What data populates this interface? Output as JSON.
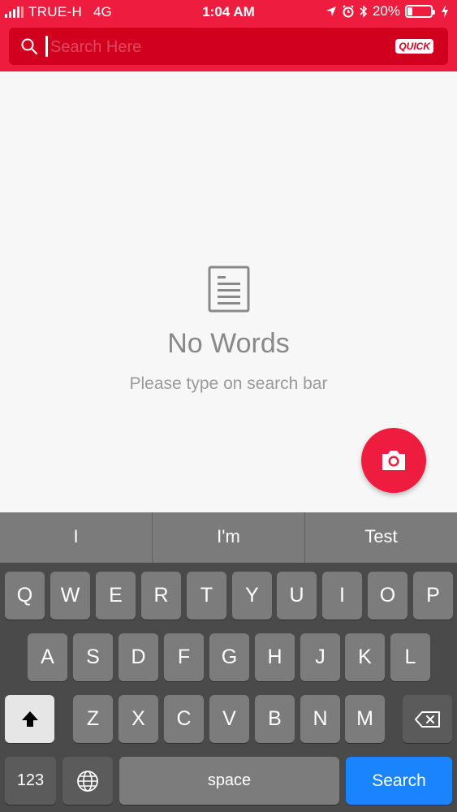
{
  "status_bar": {
    "carrier": "TRUE-H",
    "network": "4G",
    "time": "1:04 AM",
    "battery_percent": "20%",
    "battery_level": 0.2,
    "icons": [
      "location-arrow-icon",
      "alarm-icon",
      "bluetooth-icon",
      "battery-icon",
      "charging-icon"
    ]
  },
  "search": {
    "placeholder": "Search Here",
    "quick_label": "QUICK"
  },
  "empty_state": {
    "icon": "document-icon",
    "title": "No Words",
    "subtitle": "Please type on search bar"
  },
  "fab": {
    "icon": "camera-icon"
  },
  "keyboard": {
    "suggestions": [
      "I",
      "I'm",
      "Test"
    ],
    "row1": [
      "Q",
      "W",
      "E",
      "R",
      "T",
      "Y",
      "U",
      "I",
      "O",
      "P"
    ],
    "row2": [
      "A",
      "S",
      "D",
      "F",
      "G",
      "H",
      "J",
      "K",
      "L"
    ],
    "row3": [
      "Z",
      "X",
      "C",
      "V",
      "B",
      "N",
      "M"
    ],
    "numbers_label": "123",
    "space_label": "space",
    "search_label": "Search"
  },
  "colors": {
    "brand_red": "#ee1c3e",
    "search_field_red": "#d1001f",
    "keyboard_blue": "#1a84ff"
  }
}
